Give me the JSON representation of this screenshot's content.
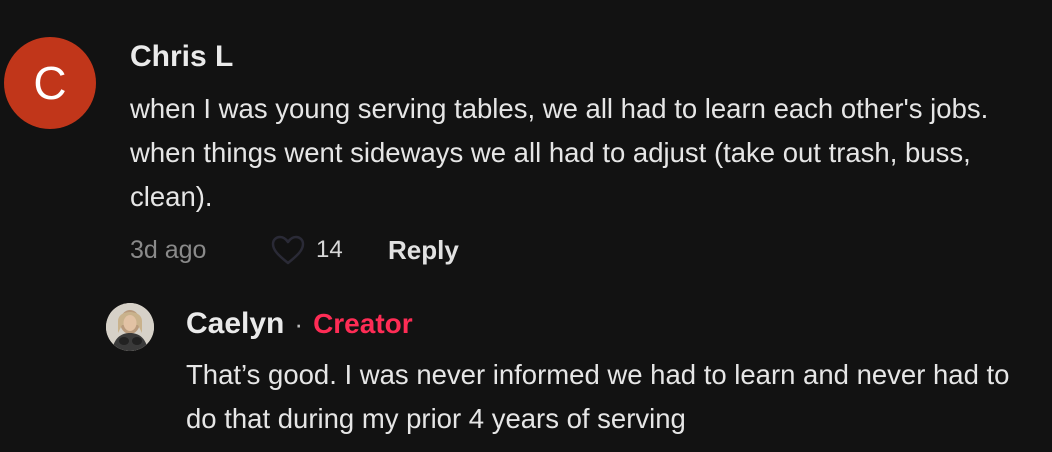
{
  "comment": {
    "avatar_letter": "C",
    "avatar_color": "#c1361a",
    "author": "Chris L",
    "text": "when I was young serving tables, we all had to learn each other's jobs. when things went sideways we all had to adjust (take out trash, buss, clean).",
    "timestamp": "3d ago",
    "like_icon": "heart-outline-icon",
    "like_count": "14",
    "reply_label": "Reply"
  },
  "reply": {
    "author": "Caelyn",
    "separator": "·",
    "badge": "Creator",
    "badge_color": "#fe2c55",
    "text": "That’s good. I was never informed we had to learn and never had to do that during my prior 4 years of serving"
  }
}
